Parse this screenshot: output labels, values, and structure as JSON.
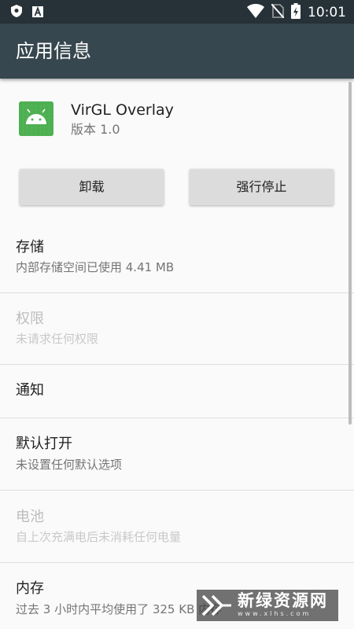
{
  "status_bar": {
    "time": "10:01",
    "icons": [
      "shield-notification-icon",
      "a-notification-icon",
      "wifi-icon",
      "no-sim-icon",
      "battery-charging-icon"
    ]
  },
  "toolbar": {
    "title": "应用信息"
  },
  "app": {
    "name": "VirGL Overlay",
    "version": "版本 1.0",
    "icon": "android-icon",
    "icon_color": "#4caf50"
  },
  "buttons": {
    "uninstall": "卸载",
    "force_stop": "强行停止"
  },
  "prefs": [
    {
      "title": "存储",
      "summary": "内部存储空间已使用 4.41 MB",
      "enabled": true
    },
    {
      "title": "权限",
      "summary": "未请求任何权限",
      "enabled": false
    },
    {
      "title": "通知",
      "summary": "",
      "enabled": true
    },
    {
      "title": "默认打开",
      "summary": "未设置任何默认选项",
      "enabled": true
    },
    {
      "title": "电池",
      "summary": "自上次充满电后未消耗任何电量",
      "enabled": false
    },
    {
      "title": "内存",
      "summary": "过去 3 小时内平均使用了 325 KB 内存",
      "enabled": true
    }
  ],
  "watermark": {
    "text": "新绿资源网",
    "sub": "www.xlhs.com"
  },
  "colors": {
    "status_bar": "#263238",
    "toolbar": "#37474f",
    "background": "#fafafa"
  }
}
